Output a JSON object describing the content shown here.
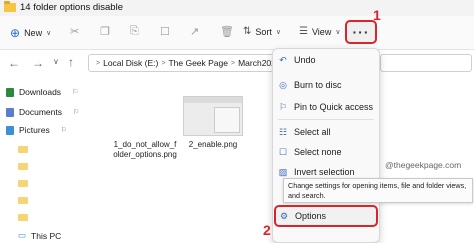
{
  "window": {
    "title": "14 folder options disable"
  },
  "commandbar": {
    "new_label": "New",
    "sort_label": "Sort",
    "view_label": "View",
    "more_label": "···",
    "callout_1": "1",
    "callout_2": "2"
  },
  "address": {
    "segments": [
      "Local Disk (E:)",
      "The Geek Page",
      "March2022"
    ],
    "separator": ">"
  },
  "sidebar": {
    "items": [
      {
        "label": "Downloads",
        "icon": "download-icon"
      },
      {
        "label": "Documents",
        "icon": "documents-icon"
      },
      {
        "label": "Pictures",
        "icon": "pictures-icon"
      }
    ],
    "this_pc": "This PC"
  },
  "files": [
    {
      "name": "1_do_not_allow_folder_options.png",
      "lines": [
        "1_do_not_allow_f",
        "older_options.png",
        "g"
      ]
    },
    {
      "name": "2_enable.png",
      "lines": [
        "2_enable.png"
      ]
    }
  ],
  "menu": {
    "items": [
      {
        "label": "Undo",
        "icon": "undo-icon"
      },
      {
        "label": "Burn to disc",
        "icon": "burn-disc-icon"
      },
      {
        "label": "Pin to Quick access",
        "icon": "pin-icon"
      },
      {
        "label": "Select all",
        "icon": "select-all-icon"
      },
      {
        "label": "Select none",
        "icon": "select-none-icon"
      },
      {
        "label": "Invert selection",
        "icon": "invert-selection-icon"
      },
      {
        "label": "Options",
        "icon": "options-icon"
      }
    ]
  },
  "tooltip": {
    "text": "Change settings for opening items, file and folder views, and search."
  },
  "watermark": "@thegeekpage.com",
  "colors": {
    "highlight": "#d6262c",
    "accent": "#2a6cc4",
    "folder": "#f5c542"
  }
}
